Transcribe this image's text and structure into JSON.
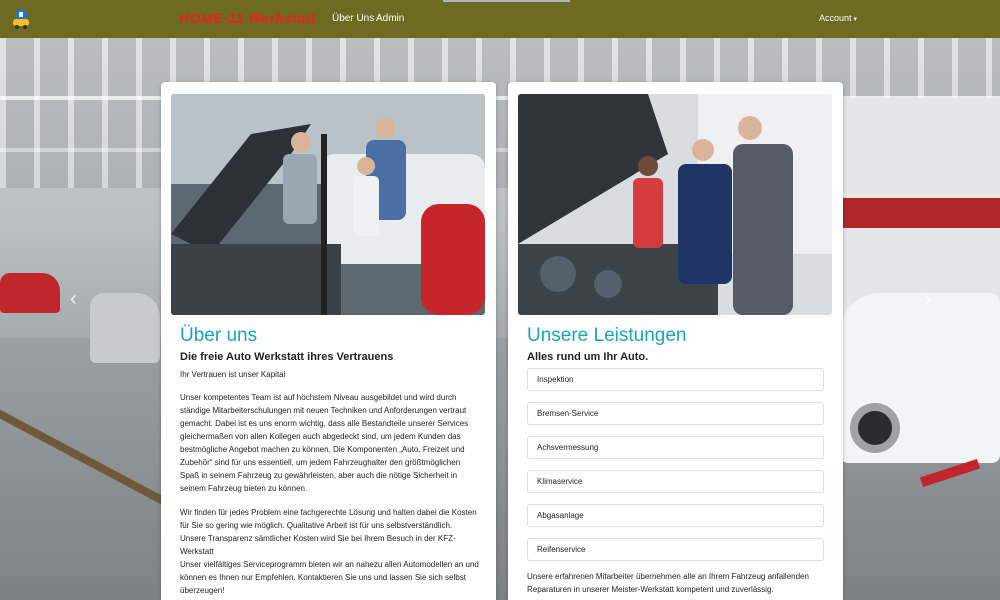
{
  "navbar": {
    "brand": "HOME-11 Werkstatt",
    "links": [
      "Über Uns",
      "Admin"
    ],
    "account": "Account",
    "account_caret": "▾"
  },
  "carousel": {
    "prev": "‹",
    "next": "›"
  },
  "about": {
    "heading": "Über uns",
    "subheading": "Die freie Auto Werkstatt ihres Vertrauens",
    "tagline": "Ihr Vertrauen ist unser Kapital",
    "paragraph1": "Unser kompetentes Team ist auf höchstem Niveau ausgebildet und wird durch ständige Mitarbeiterschulungen mit neuen Techniken und Anforderungen vertraut gemacht. Dabei ist es uns enorm wichtig, dass alle Bestandteile unserer Services gleichermaßen von allen Kollegen auch abgedeckt sind, um jedem Kunden das bestmögliche Angebot machen zu können. Die Komponenten „Auto, Freizeit und Zubehör“ sind für uns essentiell, um jedem Fahrzeughalter den größtmöglichen Spaß in seinem Fahrzeug zu gewährleisten, aber auch die nötige Sicherheit in seinem Fahrzeug bieten zu können.",
    "paragraph2": "Wir finden für jedes Problem eine fachgerechte Lösung und halten dabei die Kosten für Sie so gering wie möglich. Qualitative Arbeit ist für uns selbstverständlich. Unsere Transparenz sämtlicher Kosten wird Sie bei Ihrem Besuch in der KFZ-Werkstatt",
    "paragraph3": "Unser vielfältiges Serviceprogramm bieten wir an nahezu allen Automodellen an und können es Ihnen nur Empfehlen. Kontaktieren Sie uns und lassen Sie sich selbst überzeugen!"
  },
  "services": {
    "heading": "Unsere Leistungen",
    "subheading": "Alles rund um Ihr Auto.",
    "items": [
      "Inspektion",
      "Bremsen-Service",
      "Achsvermessung",
      "Klimaservice",
      "Abgasanlage",
      "Reifenservice"
    ],
    "footer": "Unsere erfahrenen Mitarbeiter übernehmen alle an Ihrem Fahrzeug anfallenden Reparaturen in unserer Meister-Werkstatt kompetent und zuverlässig."
  },
  "colors": {
    "navbar": "#6e6a21",
    "brand": "#e8221e",
    "heading": "#17a2c8"
  },
  "icons": {
    "logo": "car-logo-icon",
    "dropdown": "caret-down-icon"
  }
}
